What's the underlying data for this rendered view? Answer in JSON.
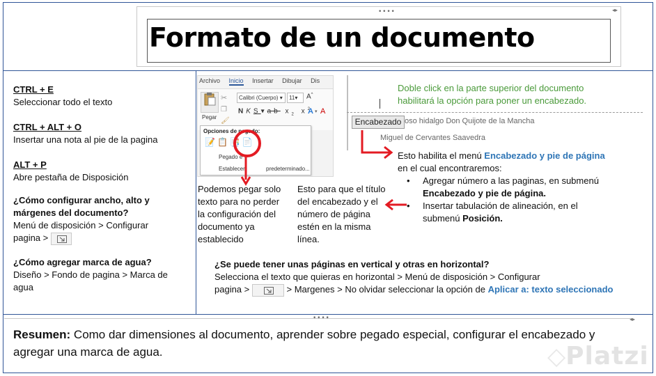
{
  "title": "Formato de un documento",
  "shortcuts": [
    {
      "key": "CTRL + E",
      "desc": "Seleccionar todo el texto"
    },
    {
      "key": "CTRL + ALT + O",
      "desc": "Insertar una nota al pie de la pagina"
    },
    {
      "key": "ALT + P",
      "desc": "Abre pestaña de Disposición"
    }
  ],
  "faq1": {
    "question": "¿Cómo configurar ancho, alto y márgenes del documento?",
    "answer_a": "Menú de disposición > Configurar",
    "answer_b": "pagina >"
  },
  "faq2": {
    "question": "¿Cómo agregar marca de agua?",
    "answer_a": "Diseño > Fondo de pagina > Marca de",
    "answer_b": "agua"
  },
  "ribbon": {
    "tabs": [
      "Archivo",
      "Inicio",
      "Insertar",
      "Dibujar",
      "Dis"
    ],
    "paste_label": "Pegar",
    "font_name": "Calibri (Cuerpo)",
    "font_size": "11",
    "menu_title": "Opciones de pegado:",
    "menu_item1": "Pegado e",
    "menu_item2": "Establecer",
    "menu_item2_tail": "predeterminado..."
  },
  "paste_note": [
    "Podemos pegar solo",
    "texto para no perder",
    "la configuración del",
    "documento ya",
    "establecido"
  ],
  "header_note": [
    "Esto para que el título",
    "del encabezado y el",
    "número de página",
    "estén en la misma",
    "línea."
  ],
  "doc": {
    "green_line1": "Doble click en la parte superior del documento",
    "green_line2": "habilitará la opción para poner un encabezado.",
    "header_tag": "Encabezado",
    "header_text": "oso hidalgo Don Quijote de la Mancha",
    "author": "Miguel de Cervantes Saavedra"
  },
  "encabezado": {
    "intro_a": "Esto habilita el menú ",
    "intro_b": "Encabezado y pie de página",
    "intro_c": "en el cual encontraremos:",
    "bullet1_a": "Agregar número a las paginas, en submenú",
    "bullet1_b": "Encabezado y pie de página.",
    "bullet2_a": "Insertar tabulación de alineación, en el",
    "bullet2_b": "submenú ",
    "bullet2_c": "Posición."
  },
  "orientation": {
    "question": "¿Se puede tener unas páginas en vertical y otras en horizontal?",
    "line1": "Selecciona el texto que quieras en horizontal > Menú de disposición > Configurar",
    "line2_a": "pagina >",
    "line2_b": "> Margenes > No olvidar seleccionar la opción de ",
    "line2_c": "Aplicar a: texto seleccionado"
  },
  "summary": {
    "label": "Resumen:",
    "text": " Como dar dimensiones al documento, aprender sobre pegado especial, configurar el encabezado y agregar una marca de agua."
  },
  "watermark": "Platzi",
  "colors": {
    "border": "#2f5597",
    "red": "#e31b23",
    "green": "#4a9a3a",
    "blue": "#2e75b6"
  }
}
